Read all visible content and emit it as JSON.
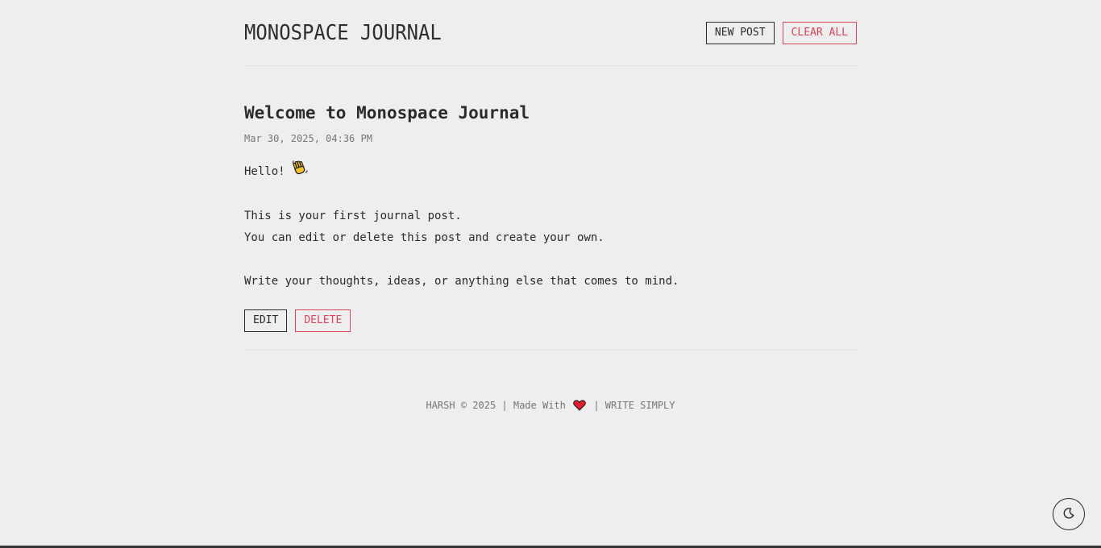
{
  "header": {
    "title": "MONOSPACE JOURNAL",
    "new_post_label": "NEW POST",
    "clear_all_label": "CLEAR ALL"
  },
  "post": {
    "title": "Welcome to Monospace Journal",
    "date": "Mar 30, 2025, 04:36 PM",
    "body": [
      "Hello! ",
      "",
      "This is your first journal post.",
      "You can edit or delete this post and create your own.",
      "",
      "Write your thoughts, ideas, or anything else that comes to mind."
    ],
    "greeting_emoji": "waving-hand",
    "edit_label": "EDIT",
    "delete_label": "DELETE"
  },
  "footer": {
    "left": "HARSH © 2025 | Made With",
    "heart_icon": "heart-icon",
    "right": "| WRITE SIMPLY"
  },
  "theme_toggle": {
    "icon": "moon-icon"
  },
  "colors": {
    "background": "#eeeeee",
    "text": "#2b2b2b",
    "muted": "#777777",
    "danger": "#d9455a"
  }
}
